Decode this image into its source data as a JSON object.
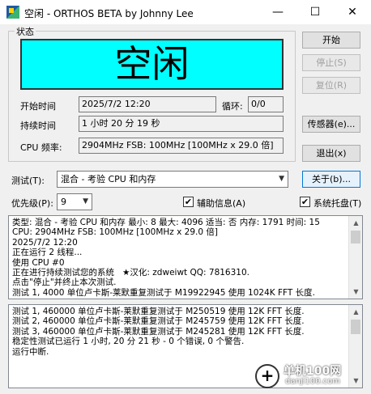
{
  "window": {
    "title": "空闲 - ORTHOS BETA by Johnny Lee",
    "minimize": "—",
    "maximize": "☐",
    "close": "✕"
  },
  "status": {
    "group_label": "状态",
    "state_text": "空闲",
    "state_color": "#00ffff",
    "start_time_label": "开始时间",
    "start_time_value": "2025/7/2 12:20",
    "loop_label": "循环:",
    "loop_value": "0/0",
    "duration_label": "持续时间",
    "duration_value": "1 小时 20 分 19 秒",
    "cpu_freq_label": "CPU 频率:",
    "cpu_freq_value": "2904MHz FSB: 100MHz [100MHz x 29.0 倍]"
  },
  "buttons": {
    "start": "开始",
    "stop": "停止(S)",
    "reset": "复位(R)",
    "sensors": "传感器(e)...",
    "exit": "退出(x)",
    "about": "关于(b)..."
  },
  "test": {
    "label": "测试(T):",
    "selected": "混合 - 考验 CPU 和内存"
  },
  "priority": {
    "label": "优先级(P):",
    "selected": "9"
  },
  "checkboxes": {
    "aux_info_label": "辅助信息(A)",
    "aux_info_checked": true,
    "tray_label": "系统托盘(T)",
    "tray_checked": true
  },
  "log_top": [
    "类型: 混合 - 考验 CPU 和内存 最小: 8 最大: 4096 适当: 否 内存: 1791 时间: 15",
    "CPU: 2904MHz FSB: 100MHz [100MHz x 29.0 倍]",
    "2025/7/2 12:20",
    "正在运行 2 线程...",
    "使用 CPU #0",
    "正在进行持续测试您的系统   ★汉化: zdweiwt QQ: 7816310.",
    "点击\"停止\"并终止本次测试.",
    "测试 1, 4000 单位卢卡斯-莱默重复测试于 M19922945 使用 1024K FFT 长度."
  ],
  "log_bottom": [
    "测试 1, 460000 单位卢卡斯-莱默重复测试于 M250519 使用 12K FFT 长度.",
    "测试 2, 460000 单位卢卡斯-莱默重复测试于 M245759 使用 12K FFT 长度.",
    "测试 3, 460000 单位卢卡斯-莱默重复测试于 M245281 使用 12K FFT 长度.",
    "稳定性测试已运行 1 小时, 20 分 21 秒 - 0 个错误, 0 个警告.",
    "运行中断."
  ],
  "watermark": {
    "site_name": "单机100网",
    "site_url": "danji100.com"
  }
}
